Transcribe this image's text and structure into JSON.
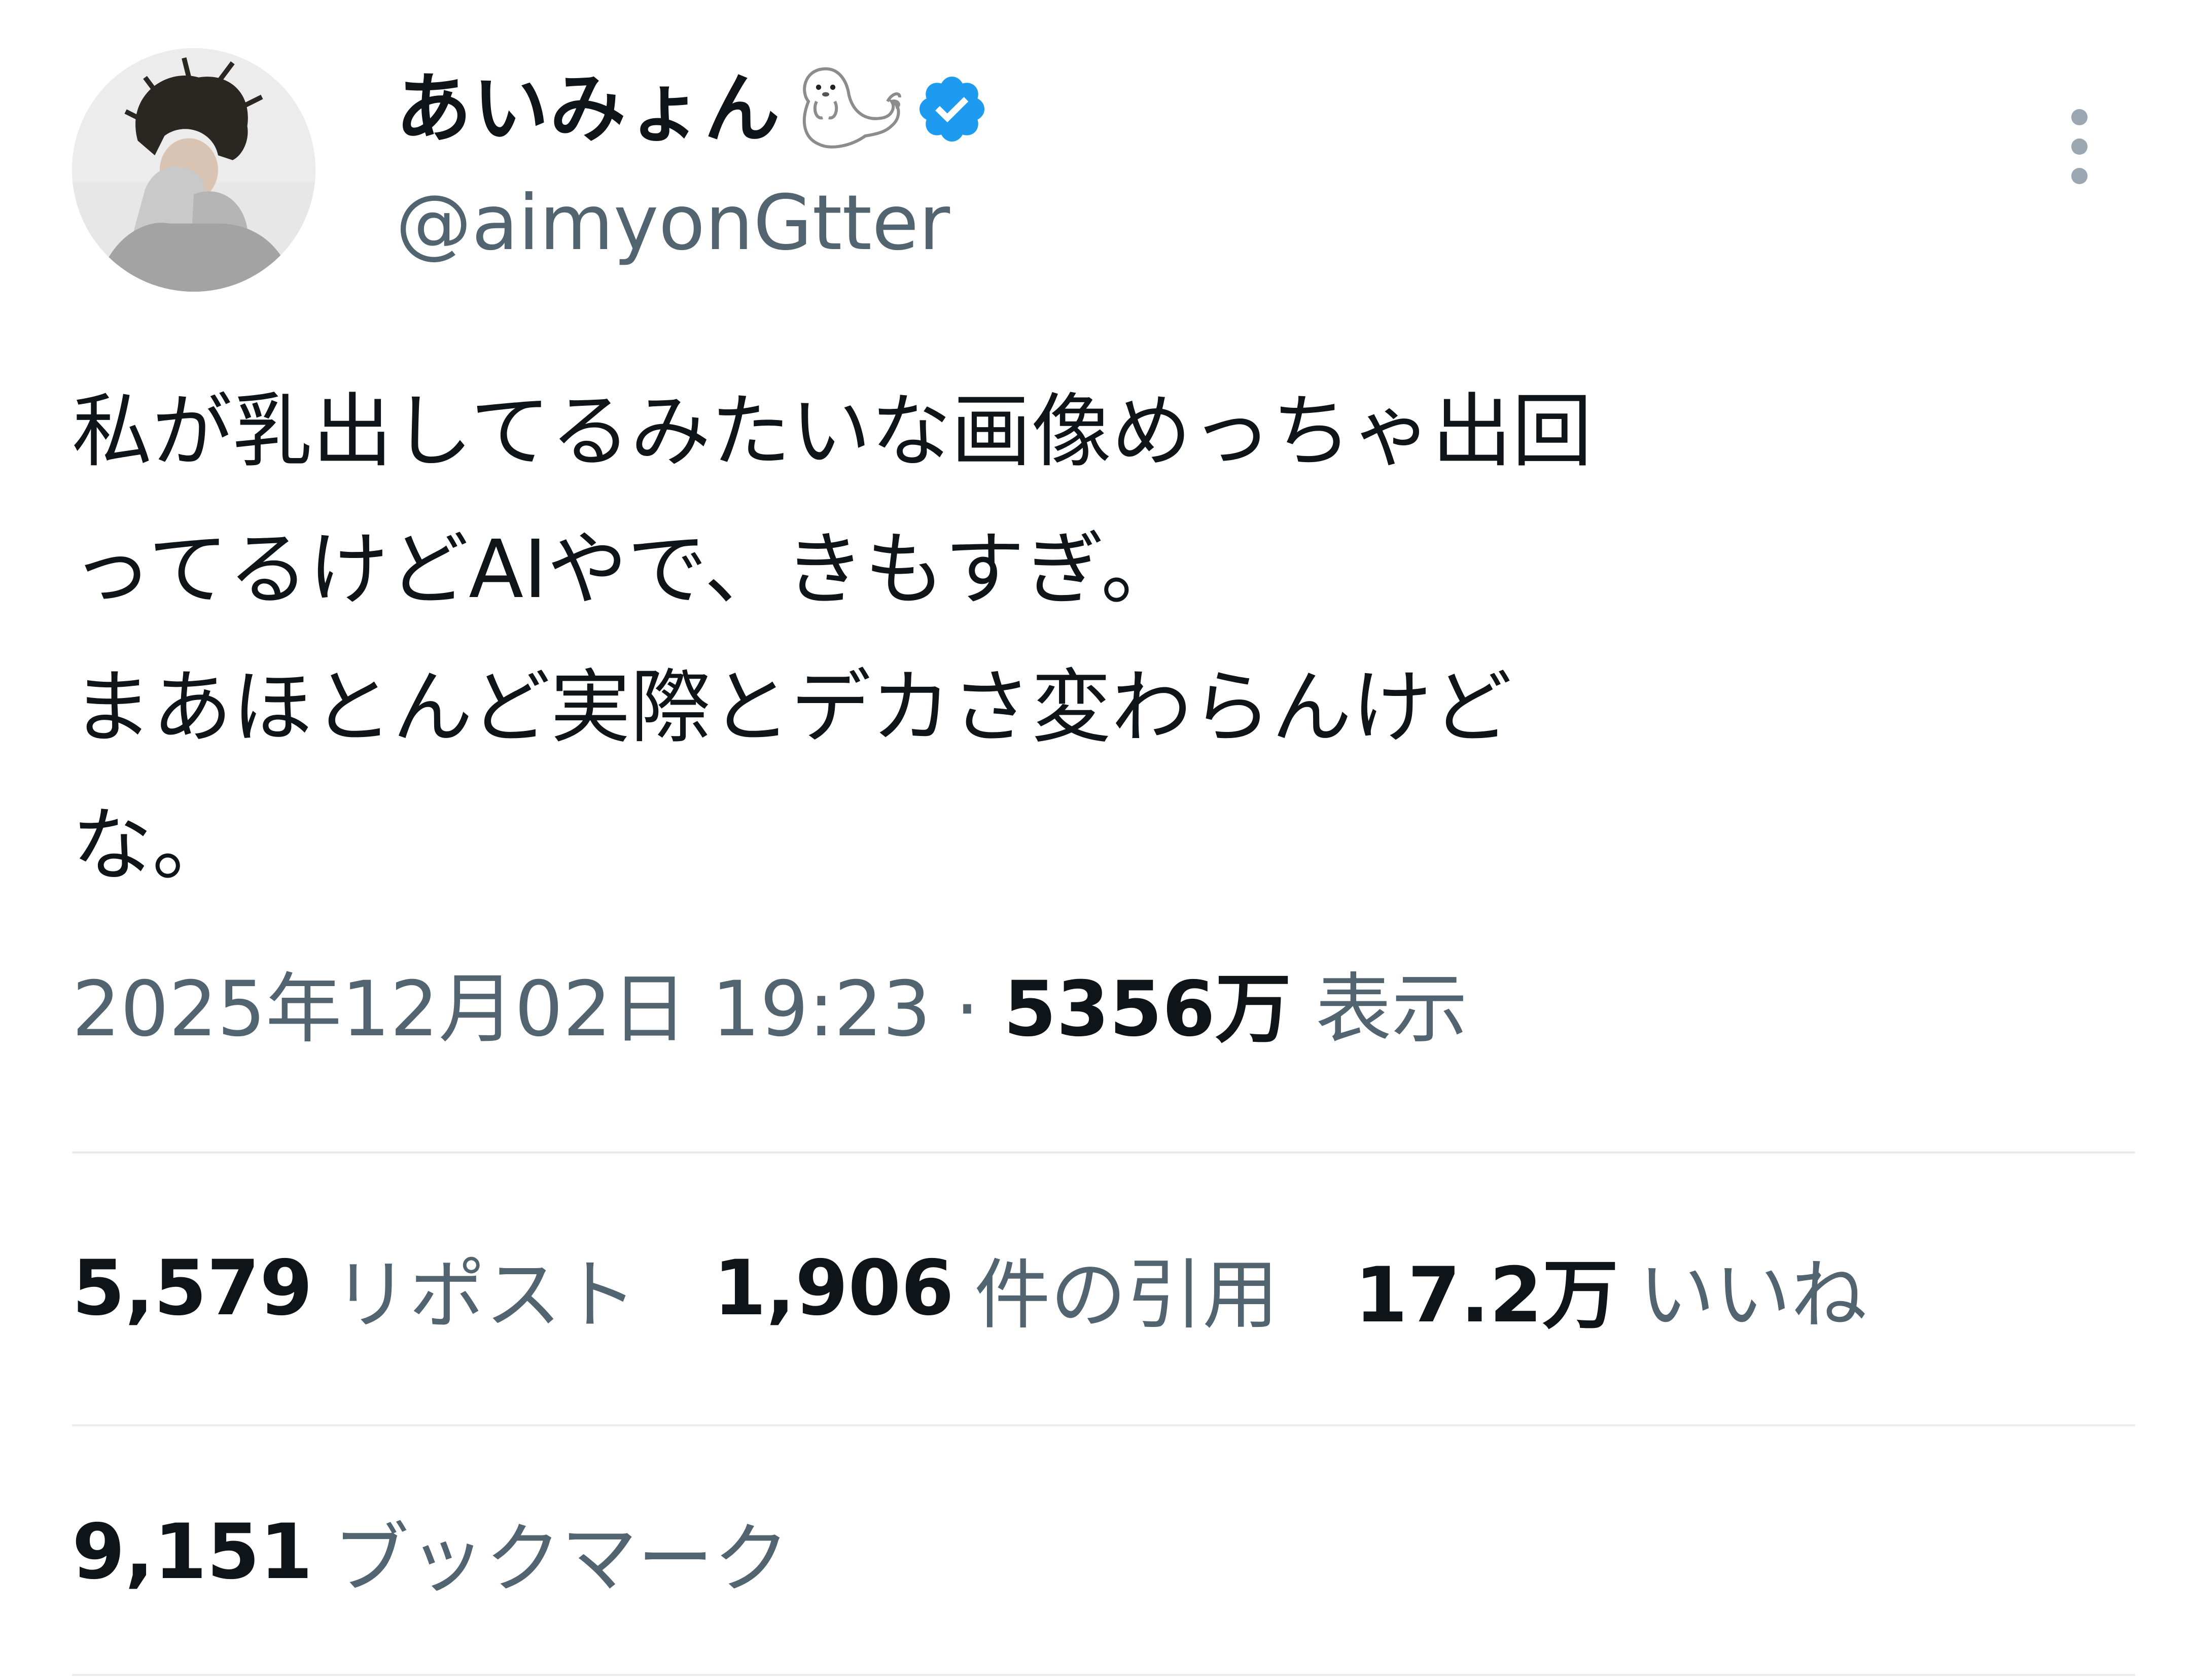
{
  "author": {
    "display_name": "あいみょん",
    "handle": "@aimyonGtter",
    "verified": true,
    "name_emoji": "seal-icon",
    "badge_color": "#1d9bf0"
  },
  "tweet": {
    "text_lines": [
      "私が乳出してるみたいな画像めっちゃ出回",
      "ってるけどAIやで、きもすぎ。",
      "まあほとんど実際とデカさ変わらんけど",
      "な。"
    ],
    "date": "2025年12月02日",
    "time": "19:23",
    "separator": "·",
    "views_count": "5356万",
    "views_label": "表示"
  },
  "stats": {
    "reposts_count": "5,579",
    "reposts_label": "リポスト",
    "quotes_count": "1,906",
    "quotes_label": "件の引用",
    "likes_count": "17.2万",
    "likes_label": "いいね",
    "bookmarks_count": "9,151",
    "bookmarks_label": "ブックマーク"
  },
  "colors": {
    "text_primary": "#0f1419",
    "text_secondary": "#536471",
    "divider": "#e6ecf0",
    "menu_dots": "#9aa6b0"
  },
  "icons": {
    "menu": "more-vertical-icon",
    "verified": "verified-badge-icon"
  }
}
